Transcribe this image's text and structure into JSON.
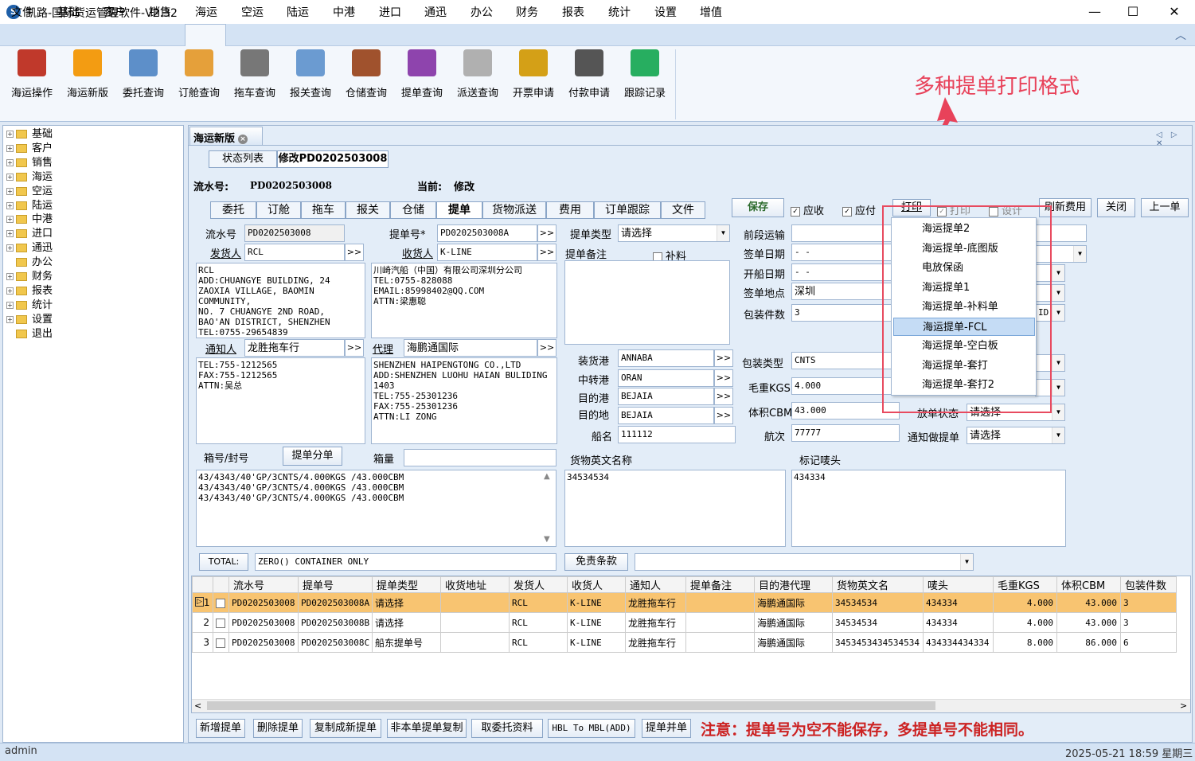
{
  "window": {
    "title": "凯路-国际货运管理软件-V2.32",
    "logo": "S",
    "minimize": "—",
    "maximize": "☐",
    "close": "✕"
  },
  "menu": [
    "文件",
    "基础",
    "客户",
    "销售",
    "海运",
    "空运",
    "陆运",
    "中港",
    "进口",
    "通迅",
    "办公",
    "财务",
    "报表",
    "统计",
    "设置",
    "增值"
  ],
  "menu_active": "海运",
  "menu_collapse": "︿",
  "ribbon": [
    {
      "label": "海运操作",
      "icon": "ship-icon",
      "color": "#c0392b"
    },
    {
      "label": "海运新版",
      "icon": "chart-icon",
      "color": "#f39c12"
    },
    {
      "label": "委托查询",
      "icon": "document-icon",
      "color": "#5d8fc9"
    },
    {
      "label": "订舱查询",
      "icon": "folder-icon",
      "color": "#e5a03a"
    },
    {
      "label": "拖车查询",
      "icon": "truck-icon",
      "color": "#777777"
    },
    {
      "label": "报关查询",
      "icon": "search-doc-icon",
      "color": "#6b9bd1"
    },
    {
      "label": "仓储查询",
      "icon": "warehouse-icon",
      "color": "#a0522d"
    },
    {
      "label": "提单查询",
      "icon": "bill-icon",
      "color": "#8e44ad"
    },
    {
      "label": "派送查询",
      "icon": "envelope-icon",
      "color": "#b0b0b0"
    },
    {
      "label": "开票申请",
      "icon": "money-icon",
      "color": "#d4a017"
    },
    {
      "label": "付款申请",
      "icon": "payment-icon",
      "color": "#555555"
    },
    {
      "label": "跟踪记录",
      "icon": "footprint-icon",
      "color": "#27ae60"
    }
  ],
  "tree": [
    "基础",
    "客户",
    "销售",
    "海运",
    "空运",
    "陆运",
    "中港",
    "进口",
    "通迅",
    "办公",
    "财务",
    "报表",
    "统计",
    "设置",
    "退出"
  ],
  "doc_tab": "海运新版",
  "doc_tab_close": "×",
  "nav_arrows": "◁ ▷ ✕",
  "sub_tabs": [
    "状态列表",
    "修改PD0202503008"
  ],
  "serial_label": "流水号:",
  "serial_value": "PD0202503008",
  "current_label": "当前:",
  "current_value": "修改",
  "form_tabs": [
    "委托",
    "订舱",
    "拖车",
    "报关",
    "仓储",
    "提单",
    "货物派送",
    "费用",
    "订单跟踪",
    "文件"
  ],
  "form_tab_active": "提单",
  "actions": {
    "save": "保存",
    "receivable": "应收",
    "payable": "应付",
    "print1": "打印",
    "print2": "打印",
    "design": "设计",
    "refresh": "刷新费用",
    "close": "关闭",
    "prev": "上一单"
  },
  "fields": {
    "flow_no_label": "流水号",
    "flow_no": "PD0202503008",
    "bl_no_label": "提单号*",
    "bl_no": "PD0202503008A",
    "bl_type_label": "提单类型",
    "bl_type": "请选择",
    "pre_transport_label": "前段运输",
    "shipper_label": "发货人",
    "shipper": "RCL",
    "consignee_label": "收货人",
    "consignee": "K-LINE",
    "bl_note_label": "提单备注",
    "supplement": "补料",
    "sign_date_label": "签单日期",
    "sign_date": "-   -",
    "sail_date_label": "开船日期",
    "sail_date": "-   -",
    "sign_place_label": "签单地点",
    "sign_place": "深圳",
    "pkg_count_label": "包装件数",
    "pkg_count": "3",
    "shipper_addr": "RCL\nADD:CHUANGYE BUILDING, 24\nZAOXIA VILLAGE, BAOMIN\nCOMMUNITY,\nNO. 7 CHUANGYE 2ND ROAD,\nBAO'AN DISTRICT, SHENZHEN\nTEL:0755-29654839",
    "consignee_addr": "川崎汽船（中国）有限公司深圳分公司\nTEL:0755-828088\nEMAIL:85998402@QQ.COM\nATTN:梁惠聪",
    "notify_label": "通知人",
    "notify": "龙胜拖车行",
    "agent_label": "代理",
    "agent": "海鹏通国际",
    "notify_addr": "TEL:755-1212565\nFAX:755-1212565\nATTN:吴总",
    "agent_addr": "SHENZHEN HAIPENGTONG CO.,LTD\nADD:SHENZHEN LUOHU HAIAN BULIDING\n1403\nTEL:755-25301236\nFAX:755-25301236\nATTN:LI ZONG",
    "pol_label": "装货港",
    "pol": "ANNABA",
    "transit_label": "中转港",
    "transit": "ORAN",
    "pod_label": "目的港",
    "pod": "BEJAIA",
    "dest_label": "目的地",
    "dest": "BEJAIA",
    "vessel_label": "船名",
    "vessel": "111112",
    "pkg_type_label": "包装类型",
    "pkg_type": "CNTS",
    "gross_label": "毛重KGS",
    "gross": "4.000",
    "volume_label": "体积CBM",
    "volume": "43.000",
    "voyage_label": "航次",
    "voyage": "77777",
    "release_label": "放单状态",
    "release": "请选择",
    "notify_bl_label": "通知做提单",
    "notify_bl": "请选择",
    "frag_id": "ID",
    "container_label": "箱号/封号",
    "split_btn": "提单分单",
    "box_qty_label": "箱量",
    "container_text": "43/4343/40'GP/3CNTS/4.000KGS /43.000CBM\n43/4343/40'GP/3CNTS/4.000KGS /43.000CBM\n43/4343/40'GP/3CNTS/4.000KGS /43.000CBM",
    "goods_en_label": "货物英文名称",
    "goods_en": "34534534",
    "marks_label": "标记唛头",
    "marks": "434334",
    "total_label": "TOTAL:",
    "total": "ZERO() CONTAINER ONLY",
    "free_terms": "免责条款"
  },
  "popup_menu": [
    "海运提单2",
    "海运提单-底图版",
    "电放保函",
    "海运提单1",
    "海运提单-补料单",
    "海运提单-FCL",
    "海运提单-空白板",
    "海运提单-套打",
    "海运提单-套打2"
  ],
  "popup_highlight": "海运提单-FCL",
  "annotation": "多种提单打印格式",
  "grid": {
    "headers": [
      "",
      "",
      "流水号",
      "提单号",
      "提单类型",
      "收货地址",
      "发货人",
      "收货人",
      "通知人",
      "提单备注",
      "目的港代理",
      "货物英文名",
      "唛头",
      "毛重KGS",
      "体积CBM",
      "包装件数"
    ],
    "rows": [
      [
        "1",
        "PD0202503008",
        "PD0202503008A",
        "请选择",
        "",
        "RCL",
        "K-LINE",
        "龙胜拖车行",
        "",
        "海鹏通国际",
        "34534534",
        "434334",
        "4.000",
        "43.000",
        "3"
      ],
      [
        "2",
        "PD0202503008",
        "PD0202503008B",
        "请选择",
        "",
        "RCL",
        "K-LINE",
        "龙胜拖车行",
        "",
        "海鹏通国际",
        "34534534",
        "434334",
        "4.000",
        "43.000",
        "3"
      ],
      [
        "3",
        "PD0202503008",
        "PD0202503008C",
        "船东提单号",
        "",
        "RCL",
        "K-LINE",
        "龙胜拖车行",
        "",
        "海鹏通国际",
        "3453453434534534",
        "434334434334",
        "8.000",
        "86.000",
        "6"
      ]
    ]
  },
  "bottom_buttons": [
    "新增提单",
    "删除提单",
    "复制成新提单",
    "非本单提单复制",
    "取委托资料",
    "HBL To MBL(ADD)",
    "提单并单"
  ],
  "notice": "注意：提单号为空不能保存，多提单号不能相同。",
  "status": {
    "user": "admin",
    "datetime": "2025-05-21 18:59 星期三"
  }
}
